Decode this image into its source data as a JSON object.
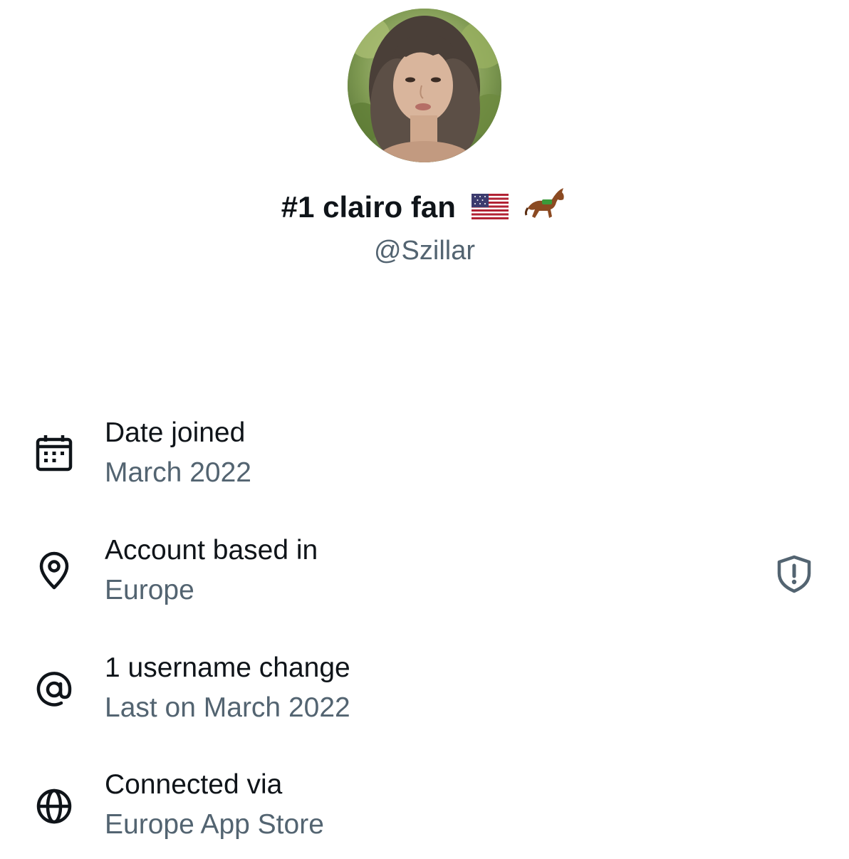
{
  "profile": {
    "display_name": "#1 clairo fan",
    "emoji_1": "flag-us-icon",
    "emoji_2": "horse-racing-icon",
    "handle": "@Szillar"
  },
  "about": {
    "date_joined": {
      "title": "Date joined",
      "value": "March 2022",
      "icon": "calendar-icon"
    },
    "based_in": {
      "title": "Account based in",
      "value": "Europe",
      "icon": "location-pin-icon",
      "action_icon": "shield-alert-icon"
    },
    "username_changes": {
      "title": "1 username change",
      "value": "Last on March 2022",
      "icon": "at-sign-icon"
    },
    "connected_via": {
      "title": "Connected via",
      "value": "Europe App Store",
      "icon": "globe-icon"
    }
  },
  "colors": {
    "primary_text": "#0f1419",
    "secondary_text": "#536471",
    "background": "#ffffff"
  }
}
